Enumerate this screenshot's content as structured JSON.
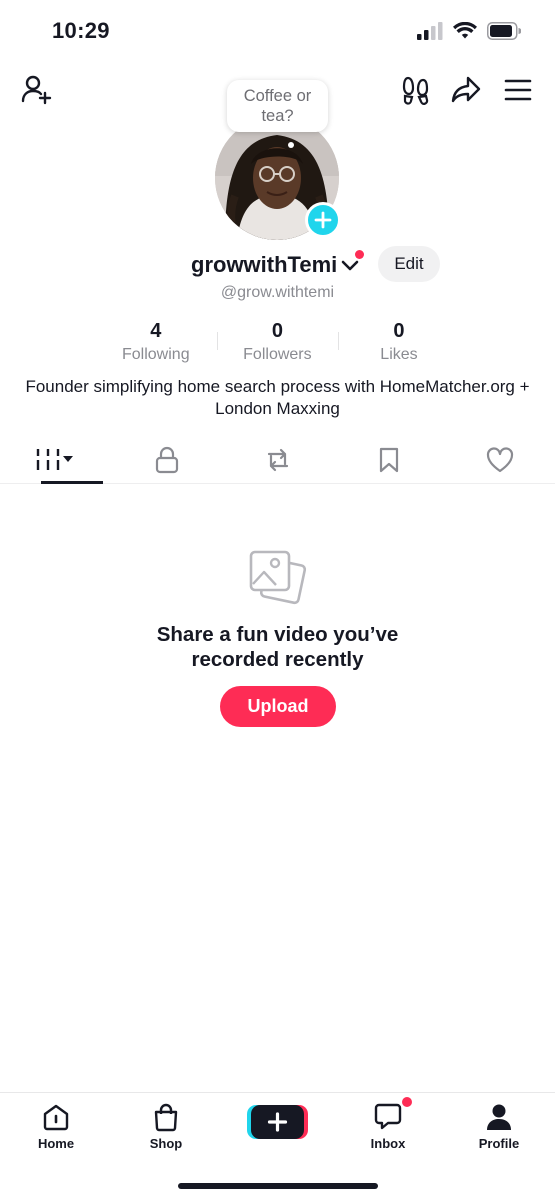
{
  "status_bar": {
    "time": "10:29"
  },
  "profile": {
    "bubble_text": "Coffee or tea?",
    "display_name": "growwithTemi",
    "edit_label": "Edit",
    "handle": "@grow.withtemi",
    "bio": "Founder simplifying home search process with HomeMatcher.org + London Maxxing"
  },
  "stats": [
    {
      "value": "4",
      "label": "Following"
    },
    {
      "value": "0",
      "label": "Followers"
    },
    {
      "value": "0",
      "label": "Likes"
    }
  ],
  "tabs": [
    {
      "icon": "videos-grid-icon",
      "active": true
    },
    {
      "icon": "lock-icon"
    },
    {
      "icon": "repost-icon"
    },
    {
      "icon": "bookmark-icon"
    },
    {
      "icon": "heart-icon"
    }
  ],
  "empty_state": {
    "title": "Share a fun video you’ve recorded recently",
    "button_label": "Upload"
  },
  "bottom_nav": {
    "home": "Home",
    "shop": "Shop",
    "inbox": "Inbox",
    "profile": "Profile"
  },
  "colors": {
    "accent": "#fe2c55",
    "cyan": "#20d5ec",
    "text": "#161823",
    "muted": "#8a8b91"
  }
}
